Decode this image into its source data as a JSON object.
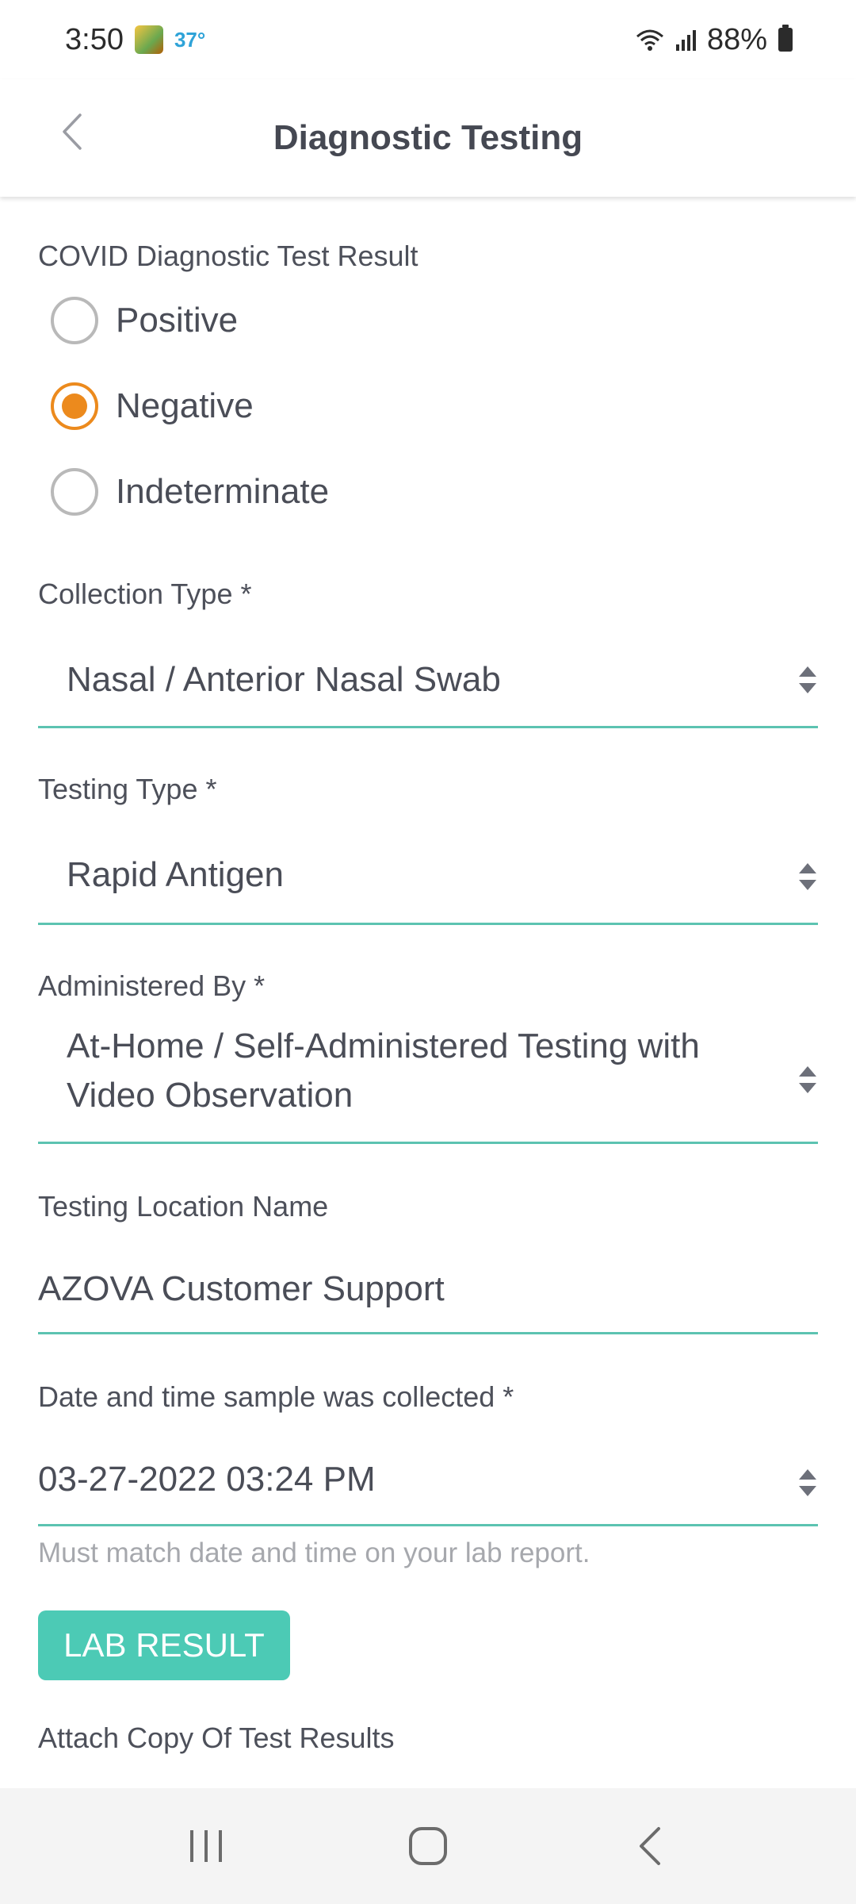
{
  "status_bar": {
    "time": "3:50",
    "temperature": "37°",
    "battery": "88%"
  },
  "header": {
    "title": "Diagnostic Testing"
  },
  "form": {
    "result_label": "COVID Diagnostic Test Result",
    "result_options": [
      "Positive",
      "Negative",
      "Indeterminate"
    ],
    "result_selected": "Negative",
    "collection_type_label": "Collection Type *",
    "collection_type_value": "Nasal / Anterior Nasal Swab",
    "testing_type_label": "Testing Type *",
    "testing_type_value": "Rapid Antigen",
    "administered_by_label": "Administered By *",
    "administered_by_value_line1": "At-Home / Self-Administered Testing with",
    "administered_by_value_line2": "Video Observation",
    "location_label": "Testing Location Name",
    "location_value": "AZOVA Customer Support",
    "date_label": "Date and time sample was collected *",
    "date_value": "03-27-2022 03:24 PM",
    "date_helper": "Must match date and time on your lab report.",
    "lab_result_button": "LAB RESULT",
    "attach_label": "Attach Copy Of Test Results"
  },
  "colors": {
    "accent_teal": "#4ccab5",
    "underline_teal": "#5cc3b1",
    "radio_orange": "#ec8a1d"
  }
}
